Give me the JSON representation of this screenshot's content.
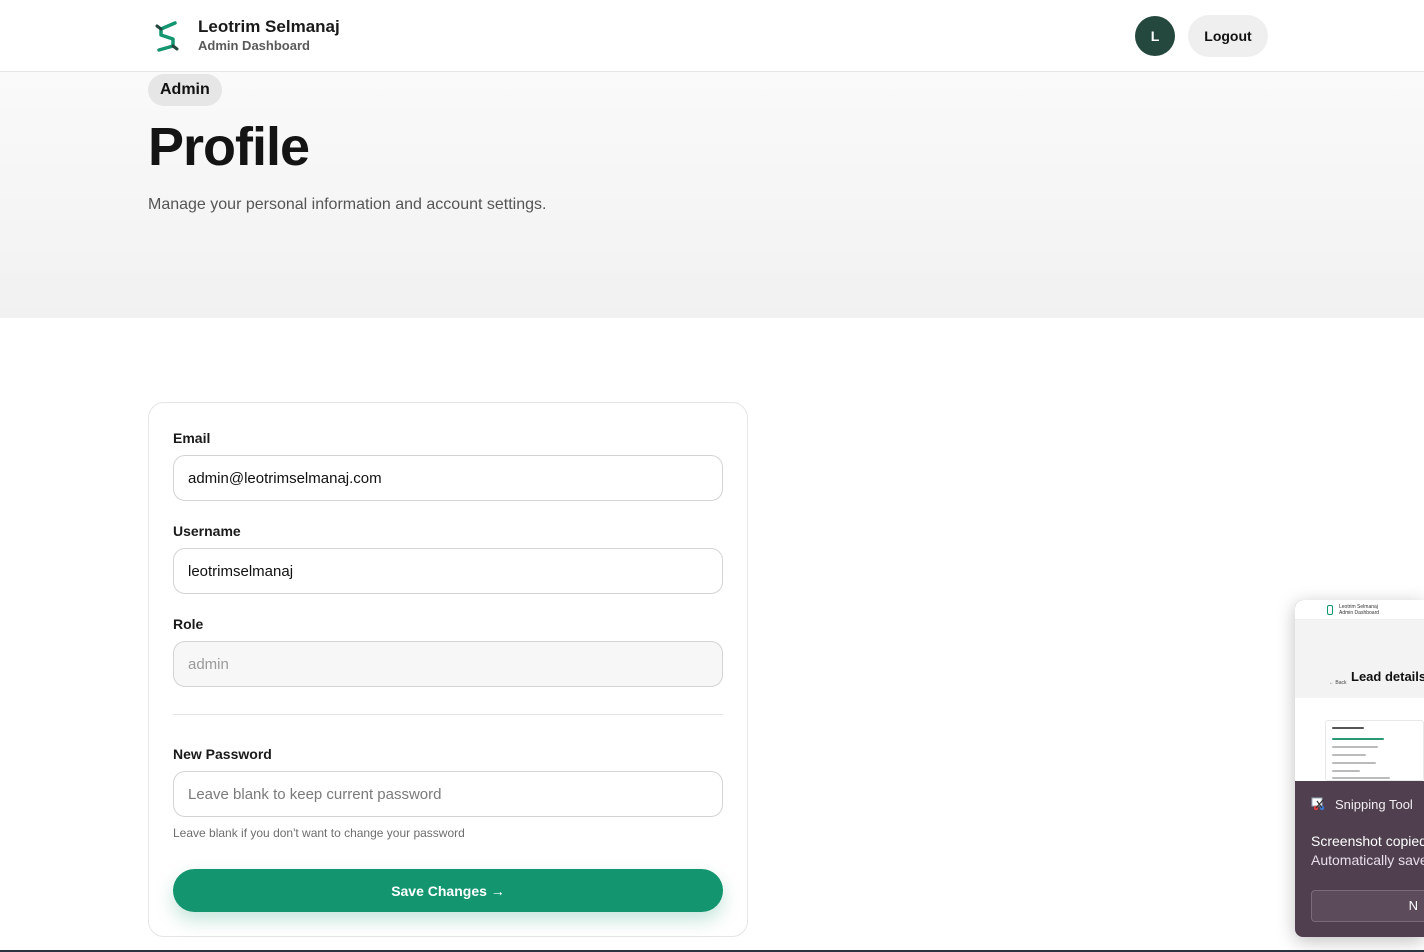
{
  "header": {
    "brand_name": "Leotrim Selmanaj",
    "brand_sub": "Admin Dashboard",
    "avatar_initial": "L",
    "logout_label": "Logout"
  },
  "hero": {
    "badge": "Admin",
    "title": "Profile",
    "subtitle": "Manage your personal information and account settings."
  },
  "form": {
    "email_label": "Email",
    "email_value": "admin@leotrimselmanaj.com",
    "username_label": "Username",
    "username_value": "leotrimselmanaj",
    "role_label": "Role",
    "role_value": "admin",
    "password_label": "New Password",
    "password_placeholder": "Leave blank to keep current password",
    "password_hint": "Leave blank if you don't want to change your password",
    "save_label": "Save Changes →"
  },
  "toast": {
    "app_name": "Snipping Tool",
    "message_line1": "Screenshot copied",
    "message_line2": "Automatically save",
    "button_label": "N",
    "preview": {
      "title": "Lead details",
      "back": "← Back",
      "name": "Leotrim Selmanaj",
      "sub": "Admin Dashboard"
    }
  },
  "colors": {
    "accent": "#139670",
    "avatar_bg": "#24473e",
    "toast_bg": "#4f3f4f"
  }
}
